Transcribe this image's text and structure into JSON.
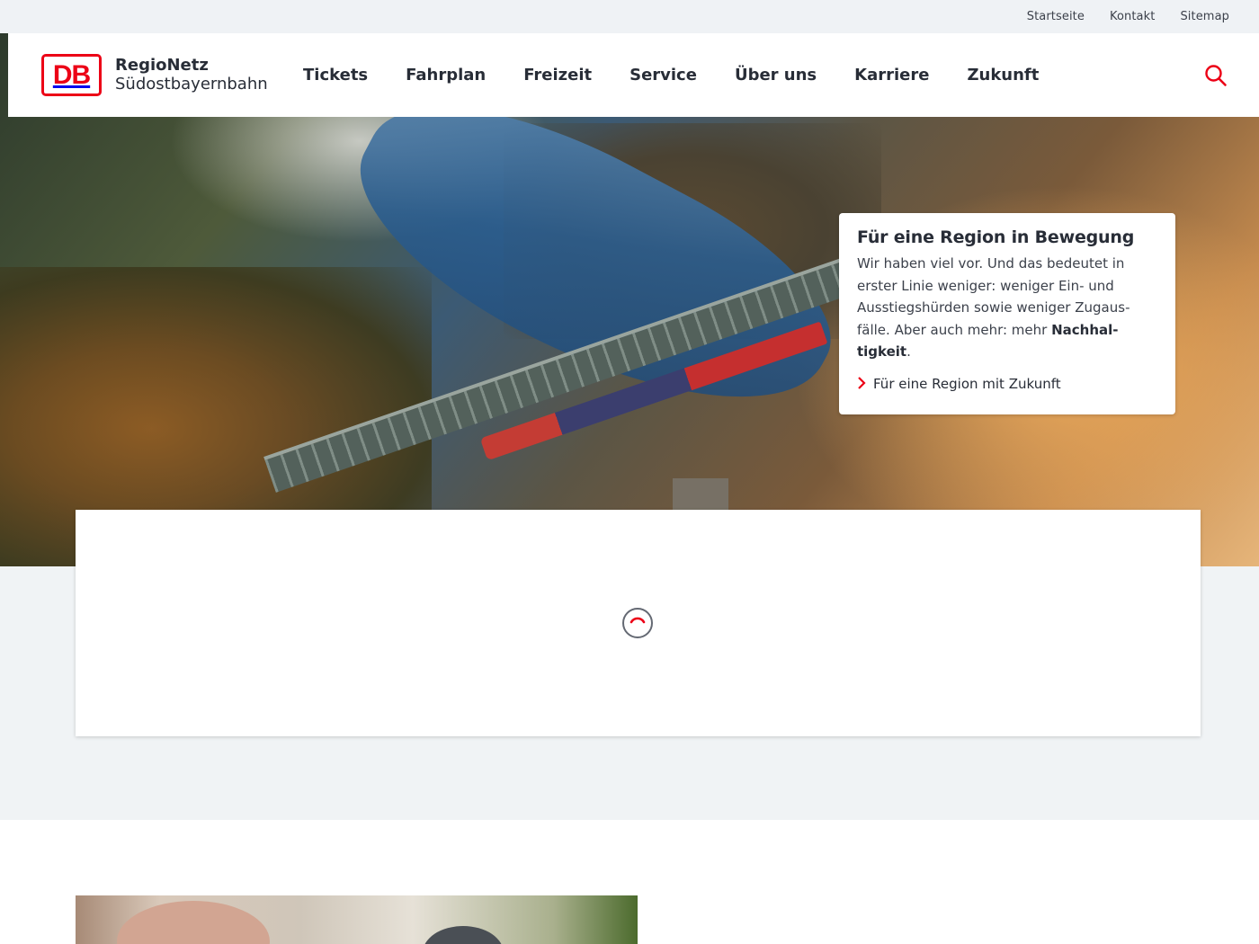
{
  "meta_nav": [
    "Startseite",
    "Kontakt",
    "Sitemap"
  ],
  "brand": {
    "logo_text": "DB",
    "line1": "RegioNetz",
    "line2": "Südostbayernbahn",
    "accent_color": "#ec0016"
  },
  "main_nav": [
    "Tickets",
    "Fahrplan",
    "Freizeit",
    "Service",
    "Über uns",
    "Karriere",
    "Zukunft"
  ],
  "search": {
    "icon": "search-icon"
  },
  "hero": {
    "title": "Für eine Region in Bewegung",
    "text_part1": "Wir haben viel vor. Und das bedeutet in erster Linie weniger: weniger Ein- und Ausstiegshürden sowie weniger Zugaus­fälle. Aber auch mehr: mehr ",
    "text_bold": "Nachhal­tigkeit",
    "text_end": ".",
    "link_label": "Für eine Region mit Zukunft",
    "link_icon": "chevron-right-icon"
  },
  "panel": {
    "state": "loading",
    "spinner_icon": "loading-spinner-icon"
  }
}
